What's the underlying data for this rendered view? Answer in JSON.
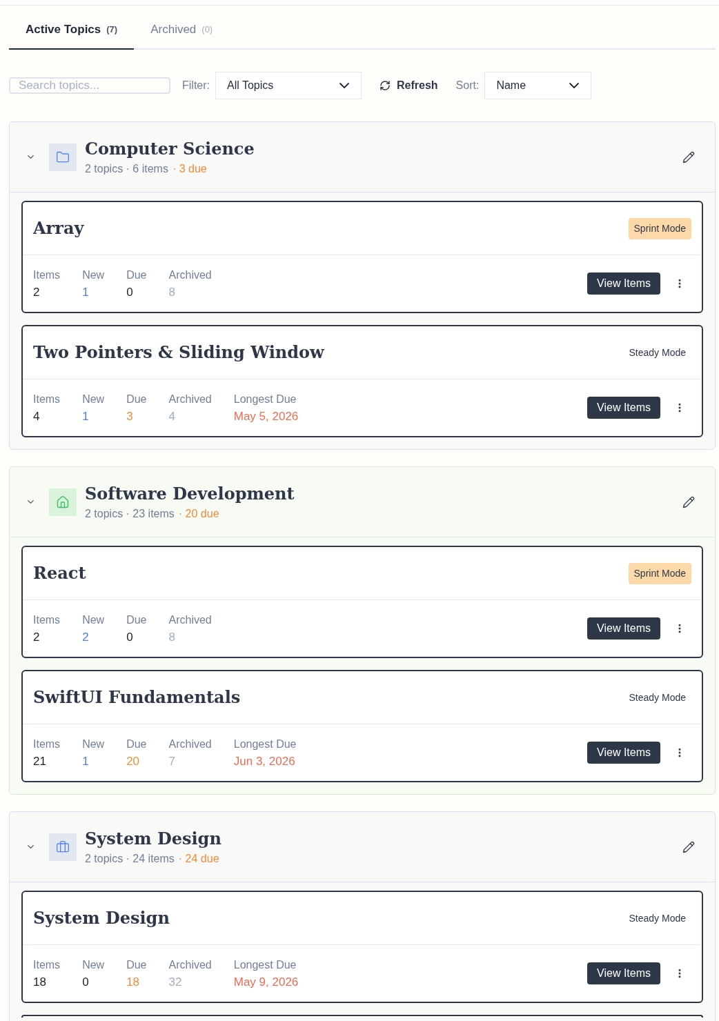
{
  "tabs": [
    {
      "label": "Active Topics",
      "count": "(7)",
      "selected": true
    },
    {
      "label": "Archived",
      "count": "(0)",
      "selected": false
    }
  ],
  "toolbar": {
    "search": {
      "placeholder": "Search topics..."
    },
    "filter": {
      "label": "Filter:",
      "value": "All Topics"
    },
    "refresh": "Refresh",
    "sort": {
      "label": "Sort:",
      "value": "Name"
    }
  },
  "groups": [
    {
      "title": "Computer Science",
      "kind": "folder",
      "expanded": true,
      "meta": "2 topics · 6 items",
      "due": "· 3 due",
      "topics": [
        {
          "title": "Array",
          "mode": {
            "label": "Sprint Mode",
            "kind": "sprint"
          },
          "stats": [
            {
              "label": "Items",
              "value": "2",
              "color": "#1a202c"
            },
            {
              "label": "New",
              "value": "1",
              "color": "#4a80e8"
            },
            {
              "label": "Due",
              "value": "0",
              "color": "#1a202c"
            },
            {
              "label": "Archived",
              "value": "8",
              "color": "#a0aec0"
            }
          ],
          "action": "View Items"
        },
        {
          "title": "Two Pointers & Sliding Window",
          "mode": {
            "label": "Steady Mode",
            "kind": "steady"
          },
          "stats": [
            {
              "label": "Items",
              "value": "4",
              "color": "#1a202c"
            },
            {
              "label": "New",
              "value": "1",
              "color": "#4a80e8"
            },
            {
              "label": "Due",
              "value": "3",
              "color": "#f08c3a"
            },
            {
              "label": "Archived",
              "value": "4",
              "color": "#a0aec0"
            },
            {
              "label": "Longest Due",
              "value": "May 5, 2026",
              "color": "#f26b50"
            }
          ],
          "action": "View Items"
        }
      ]
    },
    {
      "title": "Software Development",
      "kind": "home",
      "expanded": true,
      "meta": "2 topics · 23 items",
      "due": "· 20 due",
      "topics": [
        {
          "title": "React",
          "mode": {
            "label": "Sprint Mode",
            "kind": "sprint"
          },
          "stats": [
            {
              "label": "Items",
              "value": "2",
              "color": "#1a202c"
            },
            {
              "label": "New",
              "value": "2",
              "color": "#4a80e8"
            },
            {
              "label": "Due",
              "value": "0",
              "color": "#1a202c"
            },
            {
              "label": "Archived",
              "value": "8",
              "color": "#a0aec0"
            }
          ],
          "action": "View Items"
        },
        {
          "title": "SwiftUI Fundamentals",
          "mode": {
            "label": "Steady Mode",
            "kind": "steady"
          },
          "stats": [
            {
              "label": "Items",
              "value": "21",
              "color": "#1a202c"
            },
            {
              "label": "New",
              "value": "1",
              "color": "#4a80e8"
            },
            {
              "label": "Due",
              "value": "20",
              "color": "#f08c3a"
            },
            {
              "label": "Archived",
              "value": "7",
              "color": "#a0aec0"
            },
            {
              "label": "Longest Due",
              "value": "Jun 3, 2026",
              "color": "#f26b50"
            }
          ],
          "action": "View Items"
        }
      ]
    },
    {
      "title": "System Design",
      "kind": "briefcase",
      "expanded": true,
      "meta": "2 topics · 24 items",
      "due": "· 24 due",
      "topics": [
        {
          "title": "System Design",
          "mode": {
            "label": "Steady Mode",
            "kind": "steady"
          },
          "stats": [
            {
              "label": "Items",
              "value": "18",
              "color": "#1a202c"
            },
            {
              "label": "New",
              "value": "0",
              "color": "#1a202c"
            },
            {
              "label": "Due",
              "value": "18",
              "color": "#f08c3a"
            },
            {
              "label": "Archived",
              "value": "32",
              "color": "#a0aec0"
            },
            {
              "label": "Longest Due",
              "value": "May 9, 2026",
              "color": "#f26b50"
            }
          ],
          "action": "View Items"
        }
      ]
    }
  ]
}
